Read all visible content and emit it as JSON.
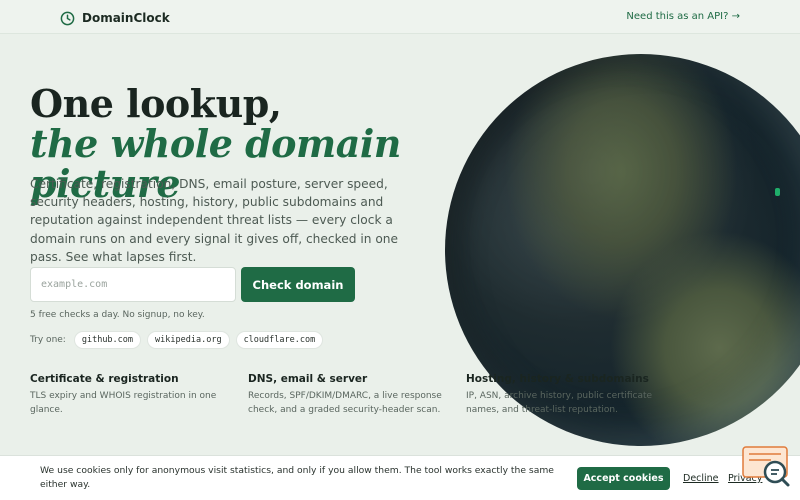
{
  "header": {
    "brand": "DomainClock",
    "api_link": "Need this as an API? →"
  },
  "hero": {
    "title_line1": "One lookup,",
    "title_line2": "the whole domain picture",
    "description": "Certificate, registration, DNS, email posture, server speed, security headers, hosting, history, public subdomains and reputation against independent threat lists — every clock a domain runs on and every signal it gives off, checked in one pass. See what lapses first."
  },
  "search": {
    "placeholder": "example.com",
    "button_label": "Check domain",
    "note": "5 free checks a day. No signup, no key."
  },
  "try_one": {
    "label": "Try one:",
    "examples": [
      "github.com",
      "wikipedia.org",
      "cloudflare.com"
    ]
  },
  "features": [
    {
      "title": "Certificate & registration",
      "desc": "TLS expiry and WHOIS registration in one glance."
    },
    {
      "title": "DNS, email & server",
      "desc": "Records, SPF/DKIM/DMARC, a live response check, and a graded security-header scan."
    },
    {
      "title": "Hosting, history & subdomains",
      "desc": "IP, ASN, archive history, public certificate names, and threat-list reputation."
    }
  ],
  "cookie": {
    "text": "We use cookies only for anonymous visit statistics, and only if you allow them. The tool works exactly the same either way.",
    "accept": "Accept cookies",
    "decline": "Decline",
    "privacy": "Privacy"
  },
  "colors": {
    "accent": "#1f6b45",
    "background": "#eaf0ea"
  },
  "icons": {
    "brand": "clock-icon",
    "widget": "chat-search-icon"
  }
}
